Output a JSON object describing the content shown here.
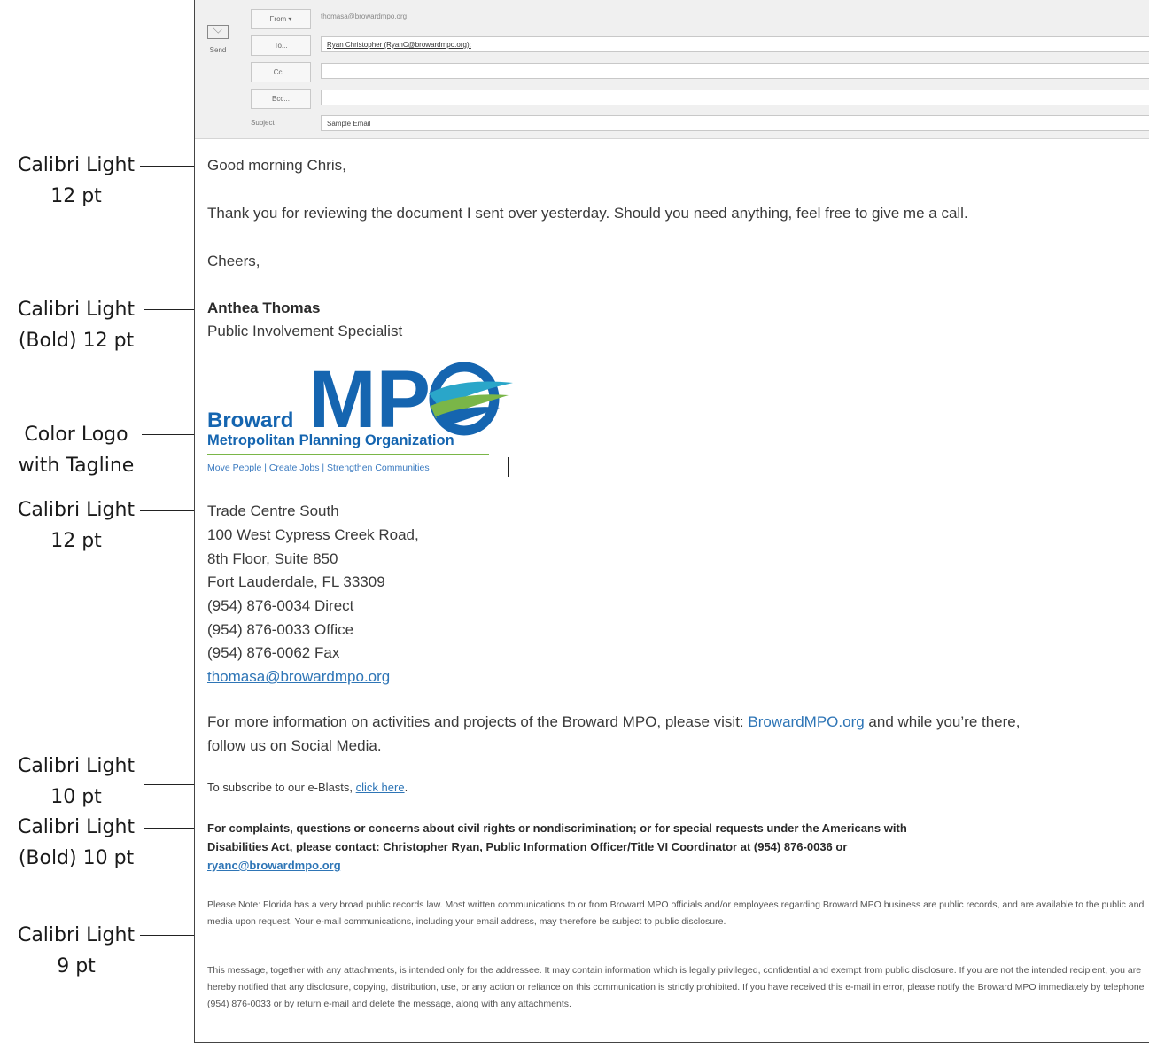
{
  "annotations": [
    {
      "line1": "Calibri Light",
      "line2": "12 pt"
    },
    {
      "line1": "Calibri Light",
      "line2": "(Bold) 12 pt"
    },
    {
      "line1": "Color Logo",
      "line2": "with Tagline"
    },
    {
      "line1": "Calibri Light",
      "line2": "12 pt"
    },
    {
      "line1": "Calibri Light",
      "line2": "10 pt"
    },
    {
      "line1": "Calibri Light",
      "line2": "(Bold) 10 pt"
    },
    {
      "line1": "Calibri Light",
      "line2": "9 pt"
    }
  ],
  "header": {
    "send_label": "Send",
    "from_label": "From ▾",
    "from_value": "thomasa@browardmpo.org",
    "to_label": "To...",
    "to_value": "Ryan Christopher (RyanC@browardmpo.org);",
    "cc_label": "Cc...",
    "bcc_label": "Bcc...",
    "subject_label": "Subject",
    "subject_value": "Sample Email"
  },
  "body": {
    "greeting": "Good morning Chris,",
    "message": "Thank you for reviewing the document I sent over yesterday. Should you need anything, feel free to give me a call.",
    "closing": "Cheers,",
    "name": "Anthea Thomas",
    "title": "Public Involvement Specialist",
    "logo": {
      "word": "Broward",
      "acronym": "MP",
      "org": "Metropolitan Planning Organization",
      "tagline": "Move People  |  Create Jobs  |  Strengthen Communities"
    },
    "address": [
      "Trade Centre South",
      "100 West Cypress Creek Road,",
      "8th Floor, Suite 850",
      "Fort Lauderdale, FL 33309",
      "(954) 876-0034 Direct",
      "(954) 876-0033 Office",
      "(954) 876-0062 Fax"
    ],
    "email": "thomasa@browardmpo.org",
    "info_prefix": "For more information on activities and projects of the Broward MPO, please visit: ",
    "info_link": "BrowardMPO.org",
    "info_suffix": " and while you’re there,",
    "info_line2": "follow us on Social Media.",
    "subscribe_prefix": "To subscribe to our e-Blasts, ",
    "subscribe_link": "click here",
    "subscribe_suffix": ".",
    "complaints_line1": "For complaints, questions or concerns about civil rights or nondiscrimination; or for special requests under the Americans with",
    "complaints_line2": "Disabilities Act, please contact: Christopher Ryan, Public Information Officer/Title VI Coordinator at (954) 876-0036 or",
    "complaints_email": "ryanc@browardmpo.org",
    "note": "Please Note: Florida has a very broad public records law. Most written communications to or from Broward MPO officials and/or employees regarding Broward MPO business are public records, and are available to the public and media upon request. Your e-mail communications, including your email address, may therefore be subject to public disclosure.",
    "disclaimer": "This message, together with any attachments, is intended only for the addressee. It may contain information which is legally privileged, confidential and exempt from public disclosure. If you are not the intended recipient, you are hereby notified that any disclosure, copying, distribution, use, or any action or reliance on this communication is strictly prohibited. If you have received this e-mail in error, please notify the Broward MPO immediately by telephone (954) 876-0033 or by return e-mail and delete the message, along with any attachments."
  },
  "colors": {
    "mpo_blue": "#1565b0",
    "mpo_green": "#7ab648",
    "mpo_teal": "#2aa6c9",
    "link_blue": "#2e75b6"
  }
}
